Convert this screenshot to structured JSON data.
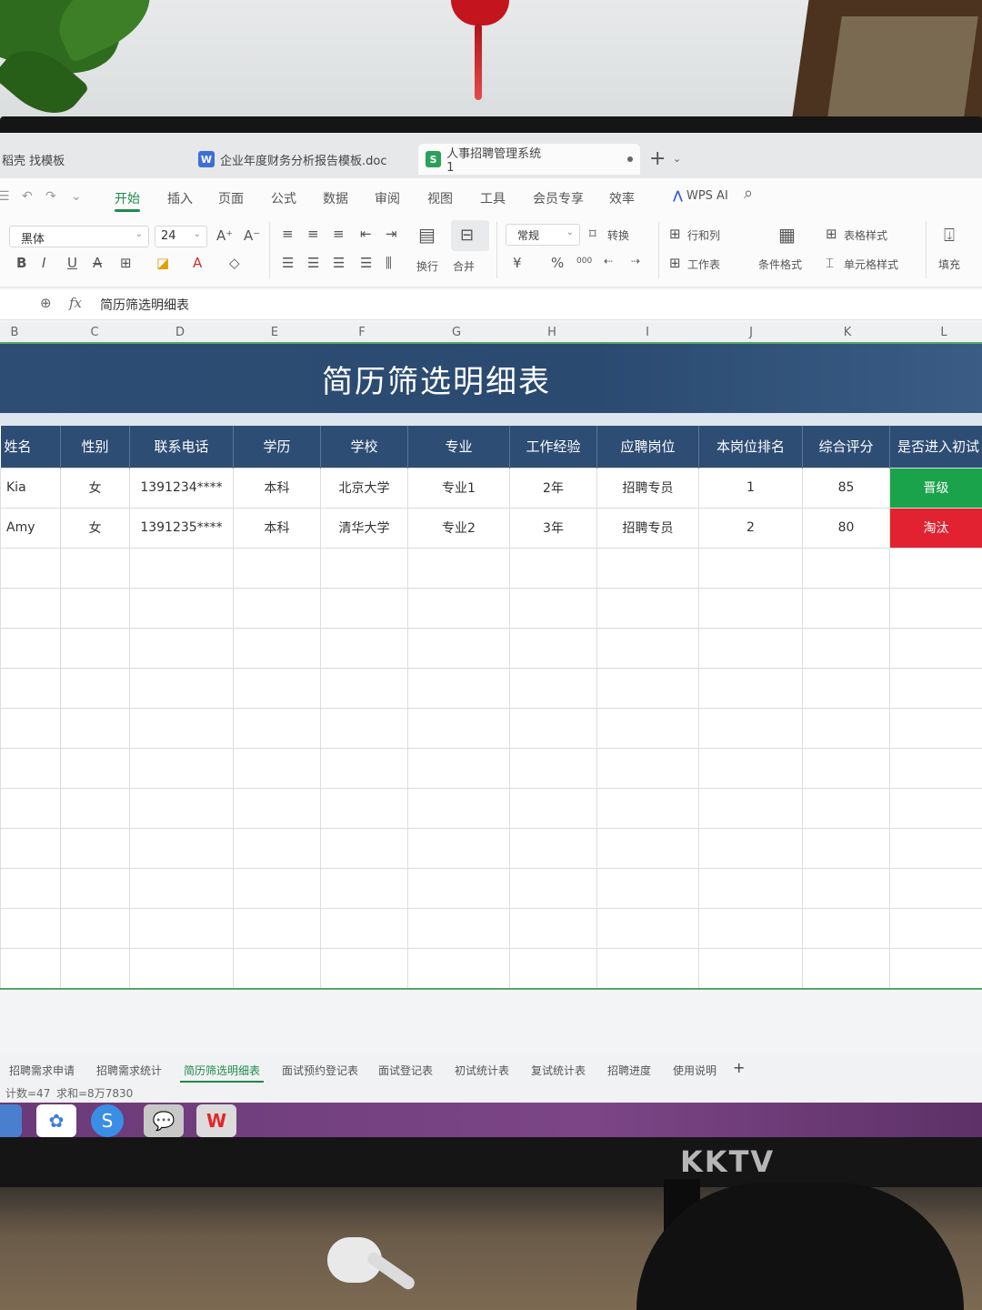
{
  "tabs": {
    "left_partial": "稻壳 找模板",
    "doc_tab": {
      "icon": "W",
      "label": "企业年度财务分析报告模板.doc"
    },
    "active_tab": {
      "icon": "S",
      "label": "人事招聘管理系统1"
    },
    "add_label": "+",
    "add_caret": "⌄"
  },
  "menu": {
    "items": [
      "开始",
      "插入",
      "页面",
      "公式",
      "数据",
      "审阅",
      "视图",
      "工具",
      "会员专享",
      "效率"
    ],
    "ai_logo": "⋀",
    "ai_label": "WPS AI"
  },
  "toolbar": {
    "font": "黑体",
    "size": "24",
    "numfmt": "常规",
    "bold": "B",
    "italic": "I",
    "underline": "U",
    "strike": "A",
    "convert": "转换",
    "wrap": "换行",
    "merge": "合并",
    "rowcol": "行和列",
    "worksheet": "工作表",
    "condfmt": "条件格式",
    "tablestyle": "表格样式",
    "cellstyle": "单元格样式",
    "fill": "填充",
    "currency": "¥",
    "percent": "%",
    "thousands": "000"
  },
  "formula": {
    "fx": "fx",
    "content": "简历筛选明细表"
  },
  "columns": [
    "B",
    "C",
    "D",
    "E",
    "F",
    "G",
    "H",
    "I",
    "J",
    "K",
    "L"
  ],
  "sheet": {
    "title": "简历筛选明细表",
    "headers": [
      "姓名",
      "性别",
      "联系电话",
      "学历",
      "学校",
      "专业",
      "工作经验",
      "应聘岗位",
      "本岗位排名",
      "综合评分",
      "是否进入初试"
    ],
    "rows": [
      [
        "Kia",
        "女",
        "1391234****",
        "本科",
        "北京大学",
        "专业1",
        "2年",
        "招聘专员",
        "1",
        "85",
        "晋级"
      ],
      [
        "Amy",
        "女",
        "1391235****",
        "本科",
        "清华大学",
        "专业2",
        "3年",
        "招聘专员",
        "2",
        "80",
        "淘汰"
      ]
    ],
    "status_colors": {
      "pass": "#1aa34a",
      "fail": "#e22230"
    },
    "header_color": "#2e4d74"
  },
  "sheet_tabs": [
    "招聘需求申请",
    "招聘需求统计",
    "简历筛选明细表",
    "面试预约登记表",
    "面试登记表",
    "初试统计表",
    "复试统计表",
    "招聘进度",
    "使用说明"
  ],
  "active_sheet": "简历筛选明细表",
  "status": {
    "count": "计数=47",
    "sum": "求和=8万7830"
  },
  "monitor": {
    "brand": "KKTV"
  },
  "taskbar_icons": [
    "app-icon",
    "pinwheel-icon",
    "sogou-icon",
    "wechat-icon",
    "wps-icon"
  ]
}
